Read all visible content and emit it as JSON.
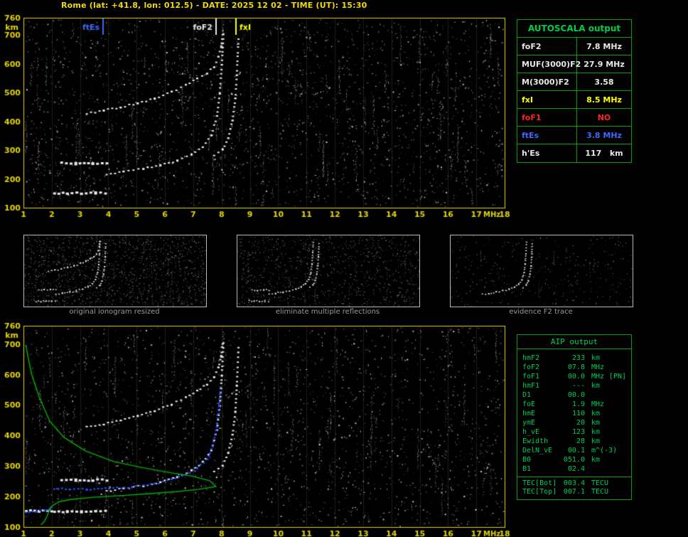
{
  "header": {
    "title": "Rome (lat: +41.8, lon: 012.5) - DATE: 2025 12 02 - TIME (UT): 15:30"
  },
  "colors": {
    "background": "#000000",
    "axis_yellow": "#e2d400",
    "title_yellow": "#f0dc00",
    "trace_white": "#e8e8e8",
    "profile_green": "#00b400",
    "restored_blue": "#2d4bff",
    "table_border_green": "#00a400",
    "aip_text_green": "#00cc55",
    "caption_gray": "#9a9a9a",
    "value_colors": {
      "white": "#e8e8e8",
      "yellow": "#ffff00",
      "red": "#ff2222",
      "blue": "#4169ff"
    }
  },
  "autoscala": {
    "title": "AUTOSCALA output",
    "rows": [
      {
        "label": "foF2",
        "value": "7.8 MHz",
        "color_key": "white"
      },
      {
        "label": "MUF(3000)F2",
        "value": "27.9 MHz",
        "color_key": "white"
      },
      {
        "label": "M(3000)F2",
        "value": "3.58",
        "color_key": "white"
      },
      {
        "label": "fxI",
        "value": "8.5 MHz",
        "color_key": "yellow"
      },
      {
        "label": "foF1",
        "value": "NO",
        "color_key": "red"
      },
      {
        "label": "ftEs",
        "value": "3.8 MHz",
        "color_key": "blue"
      },
      {
        "label": "h'Es",
        "value": "117   km",
        "color_key": "white"
      }
    ]
  },
  "aip": {
    "title": "AIP output",
    "rows": [
      {
        "label": "hmF2",
        "value": "233",
        "unit": "km"
      },
      {
        "label": "foF2",
        "value": "07.8",
        "unit": "MHz"
      },
      {
        "label": "foF1",
        "value": "00.0",
        "unit": "MHz",
        "note": "[PN]"
      },
      {
        "label": "hmF1",
        "value": "---",
        "unit": "km"
      },
      {
        "label": "D1",
        "value": "00.0",
        "unit": ""
      },
      {
        "label": "foE",
        "value": "1.9",
        "unit": "MHz"
      },
      {
        "label": "hmE",
        "value": "110",
        "unit": "km"
      },
      {
        "label": "ymE",
        "value": "20",
        "unit": "km"
      },
      {
        "label": "h_vE",
        "value": "123",
        "unit": "km"
      },
      {
        "label": "Ewidth",
        "value": "28",
        "unit": "km"
      },
      {
        "label": "DelN_vE",
        "value": "00.1",
        "unit": "m^(-3)"
      },
      {
        "label": "B0",
        "value": "051.0",
        "unit": "km"
      },
      {
        "label": "B1",
        "value": "02.4",
        "unit": ""
      },
      {
        "label": "TEC[Bot]",
        "value": "003.4",
        "unit": "TECU",
        "separator_before": true
      },
      {
        "label": "TEC[Top]",
        "value": "007.1",
        "unit": "TECU"
      }
    ]
  },
  "thumbnails": [
    {
      "caption": "original ionogram resized",
      "shows": "all"
    },
    {
      "caption": "eliminate multiple reflections",
      "shows": "no-multiples"
    },
    {
      "caption": "evidence F2 trace",
      "shows": "f2-only"
    }
  ],
  "chart_data": [
    {
      "id": "scaled_ionogram",
      "type": "scatter",
      "title": "scaled ionogram with AUTOSCALA characteristic frequencies",
      "xlabel": "MHz",
      "ylabel": "km",
      "xlim": [
        1,
        18
      ],
      "ylim": [
        100,
        760
      ],
      "x_ticks": [
        1,
        2,
        3,
        4,
        5,
        6,
        7,
        8,
        9,
        10,
        11,
        12,
        13,
        14,
        15,
        16,
        17,
        18
      ],
      "y_ticks": [
        100,
        200,
        300,
        400,
        500,
        600,
        700,
        760
      ],
      "grid": "faint vertical lines at integer MHz",
      "markers": [
        {
          "name": "ftEs",
          "freq_mhz": 3.8,
          "color_key": "blue",
          "label_side": "left"
        },
        {
          "name": "foF2",
          "freq_mhz": 7.8,
          "color_key": "white",
          "label_side": "left"
        },
        {
          "name": "fxI",
          "freq_mhz": 8.5,
          "color_key": "yellow",
          "label_side": "right"
        }
      ],
      "series": [
        {
          "name": "Es-trace",
          "kind": "es",
          "points_mhz_km": [
            [
              2.05,
              155
            ],
            [
              2.5,
              154
            ],
            [
              3.0,
              154
            ],
            [
              3.5,
              155
            ],
            [
              3.85,
              155
            ]
          ]
        },
        {
          "name": "Es-second-trace",
          "kind": "es",
          "points_mhz_km": [
            [
              2.3,
              258
            ],
            [
              2.8,
              257
            ],
            [
              3.4,
              257
            ],
            [
              3.9,
              258
            ]
          ]
        },
        {
          "name": "F2-O-trace",
          "kind": "f2",
          "points_mhz_km": [
            [
              3.9,
              220
            ],
            [
              4.5,
              228
            ],
            [
              5.2,
              238
            ],
            [
              5.8,
              250
            ],
            [
              6.4,
              266
            ],
            [
              6.9,
              288
            ],
            [
              7.3,
              315
            ],
            [
              7.6,
              355
            ],
            [
              7.8,
              420
            ],
            [
              7.9,
              500
            ],
            [
              7.97,
              600
            ],
            [
              8.03,
              705
            ]
          ]
        },
        {
          "name": "F2-X-trace",
          "kind": "f2",
          "points_mhz_km": [
            [
              7.7,
              283
            ],
            [
              8.0,
              305
            ],
            [
              8.2,
              345
            ],
            [
              8.35,
              405
            ],
            [
              8.45,
              480
            ],
            [
              8.5,
              565
            ],
            [
              8.56,
              690
            ]
          ]
        },
        {
          "name": "F2-multiple-trace",
          "kind": "multiple",
          "points_mhz_km": [
            [
              3.2,
              430
            ],
            [
              3.8,
              440
            ],
            [
              4.4,
              452
            ],
            [
              5.0,
              466
            ],
            [
              5.6,
              482
            ],
            [
              6.2,
              505
            ],
            [
              6.7,
              528
            ],
            [
              7.1,
              550
            ],
            [
              7.45,
              570
            ],
            [
              7.7,
              592
            ],
            [
              7.85,
              625
            ],
            [
              7.95,
              662
            ],
            [
              8.0,
              705
            ]
          ]
        }
      ]
    },
    {
      "id": "restored_ionogram_profile",
      "type": "scatter",
      "title": "ionogram with AIP restored trace and electron density profile",
      "xlabel": "MHz",
      "ylabel": "km",
      "xlim": [
        1,
        18
      ],
      "ylim": [
        100,
        760
      ],
      "x_ticks": [
        1,
        2,
        3,
        4,
        5,
        6,
        7,
        8,
        9,
        10,
        11,
        12,
        13,
        14,
        15,
        16,
        17,
        18
      ],
      "y_ticks": [
        100,
        200,
        300,
        400,
        500,
        600,
        700,
        760
      ],
      "grid": "faint vertical lines at integer MHz",
      "markers": [],
      "series": [
        {
          "name": "E-trace",
          "kind": "es",
          "points_mhz_km": [
            [
              1.05,
              157
            ],
            [
              1.5,
              156
            ],
            [
              1.95,
              156
            ]
          ]
        },
        {
          "name": "Es-trace",
          "kind": "es",
          "points_mhz_km": [
            [
              2.05,
              155
            ],
            [
              2.5,
              154
            ],
            [
              3.0,
              154
            ],
            [
              3.5,
              155
            ],
            [
              3.85,
              155
            ]
          ]
        },
        {
          "name": "Es-second-trace",
          "kind": "es",
          "points_mhz_km": [
            [
              2.3,
              258
            ],
            [
              2.8,
              257
            ],
            [
              3.4,
              257
            ],
            [
              3.9,
              258
            ]
          ]
        },
        {
          "name": "F2-O-trace",
          "kind": "f2",
          "points_mhz_km": [
            [
              3.9,
              220
            ],
            [
              4.5,
              228
            ],
            [
              5.2,
              238
            ],
            [
              5.8,
              250
            ],
            [
              6.4,
              266
            ],
            [
              6.9,
              288
            ],
            [
              7.3,
              315
            ],
            [
              7.6,
              355
            ],
            [
              7.8,
              420
            ],
            [
              7.9,
              500
            ],
            [
              7.97,
              600
            ],
            [
              8.03,
              705
            ]
          ]
        },
        {
          "name": "F2-X-trace",
          "kind": "f2",
          "points_mhz_km": [
            [
              7.7,
              283
            ],
            [
              8.0,
              305
            ],
            [
              8.2,
              345
            ],
            [
              8.35,
              405
            ],
            [
              8.45,
              480
            ],
            [
              8.5,
              565
            ],
            [
              8.56,
              690
            ]
          ]
        },
        {
          "name": "F2-multiple-trace",
          "kind": "multiple",
          "points_mhz_km": [
            [
              3.2,
              430
            ],
            [
              3.8,
              440
            ],
            [
              4.4,
              452
            ],
            [
              5.0,
              466
            ],
            [
              5.6,
              482
            ],
            [
              6.2,
              505
            ],
            [
              6.7,
              528
            ],
            [
              7.1,
              550
            ],
            [
              7.45,
              570
            ],
            [
              7.7,
              592
            ],
            [
              7.85,
              625
            ],
            [
              7.95,
              662
            ],
            [
              8.0,
              705
            ]
          ]
        },
        {
          "name": "restored-E-trace",
          "kind": "model-blue",
          "points_mhz_km": [
            [
              1.05,
              150
            ],
            [
              1.4,
              152
            ],
            [
              1.7,
              156
            ],
            [
              1.9,
              162
            ],
            [
              1.95,
              170
            ]
          ]
        },
        {
          "name": "restored-F-trace",
          "kind": "model-blue",
          "points_mhz_km": [
            [
              2.05,
              228
            ],
            [
              2.6,
              226
            ],
            [
              3.2,
              226
            ],
            [
              4.0,
              228
            ],
            [
              4.8,
              234
            ],
            [
              5.6,
              244
            ],
            [
              6.2,
              257
            ],
            [
              6.7,
              274
            ],
            [
              7.1,
              295
            ],
            [
              7.45,
              325
            ],
            [
              7.65,
              368
            ],
            [
              7.8,
              430
            ],
            [
              7.88,
              500
            ],
            [
              7.93,
              560
            ]
          ]
        },
        {
          "name": "electron-density-profile",
          "kind": "model-green",
          "points_mhz_km": [
            [
              1.08,
              697
            ],
            [
              1.2,
              640
            ],
            [
              1.3,
              598
            ],
            [
              1.55,
              528
            ],
            [
              1.93,
              447
            ],
            [
              2.43,
              394
            ],
            [
              3.18,
              350
            ],
            [
              4.19,
              315
            ],
            [
              5.19,
              295
            ],
            [
              6.2,
              278
            ],
            [
              6.95,
              267
            ],
            [
              7.58,
              252
            ],
            [
              7.8,
              233
            ],
            [
              7.2,
              224
            ],
            [
              6.4,
              216
            ],
            [
              5.4,
              209
            ],
            [
              4.4,
              203
            ],
            [
              3.4,
              197
            ],
            [
              2.7,
              191
            ],
            [
              2.3,
              184
            ],
            [
              2.05,
              172
            ],
            [
              1.93,
              158
            ],
            [
              1.84,
              138
            ],
            [
              1.75,
              120
            ],
            [
              1.62,
              107
            ]
          ]
        }
      ]
    }
  ]
}
